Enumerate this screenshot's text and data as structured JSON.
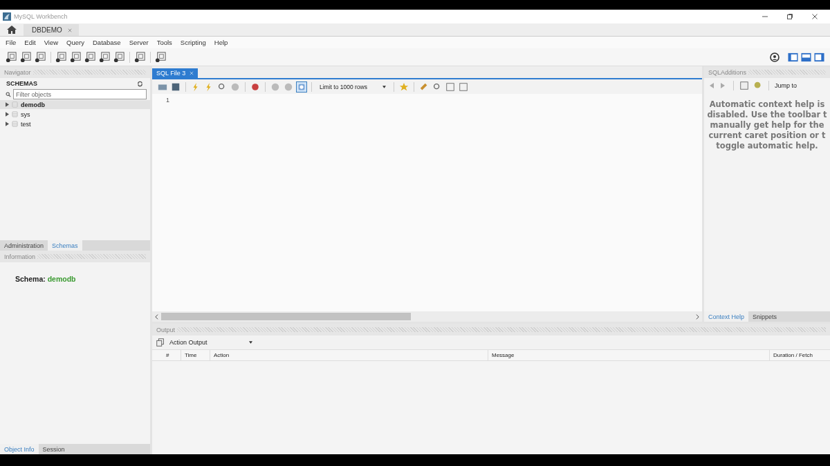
{
  "window": {
    "title": "MySQL Workbench"
  },
  "tabs": [
    {
      "label": "DBDEMO",
      "selected": true
    }
  ],
  "menu": [
    "File",
    "Edit",
    "View",
    "Query",
    "Database",
    "Server",
    "Tools",
    "Scripting",
    "Help"
  ],
  "panel_toggles": [
    {
      "selected": true
    },
    {
      "selected": true
    },
    {
      "selected": true
    }
  ],
  "navigator": {
    "title": "Navigator",
    "schemas_heading": "SCHEMAS",
    "filter": {
      "placeholder": "Filter objects"
    },
    "schemas": [
      {
        "label": "demodb",
        "selected": true
      },
      {
        "label": "sys",
        "selected": false
      },
      {
        "label": "test",
        "selected": false
      }
    ],
    "tabs": [
      {
        "label": "Administration",
        "selected": false
      },
      {
        "label": "Schemas",
        "selected": true
      }
    ]
  },
  "information": {
    "title": "Information",
    "label": "Schema:",
    "value": "demodb",
    "tabs": [
      {
        "label": "Object Info",
        "selected": true
      },
      {
        "label": "Session",
        "selected": false
      }
    ]
  },
  "editor": {
    "tabs": [
      {
        "label": "SQL File 3",
        "selected": true
      }
    ],
    "toggle_selected": true,
    "limit": "Limit to 1000 rows",
    "line_numbers": [
      "1"
    ]
  },
  "sql_additions": {
    "title": "SQLAdditions",
    "jump_to": "Jump to",
    "help_lines": [
      "Automatic context help is",
      "disabled. Use the toolbar t",
      "manually get help for the",
      "current caret position or t",
      "toggle automatic help."
    ],
    "tabs": [
      {
        "label": "Context Help",
        "selected": true
      },
      {
        "label": "Snippets",
        "selected": false
      }
    ]
  },
  "output": {
    "title": "Output",
    "selector": "Action Output",
    "columns": [
      "#",
      "Time",
      "Action",
      "Message",
      "Duration / Fetch"
    ]
  }
}
